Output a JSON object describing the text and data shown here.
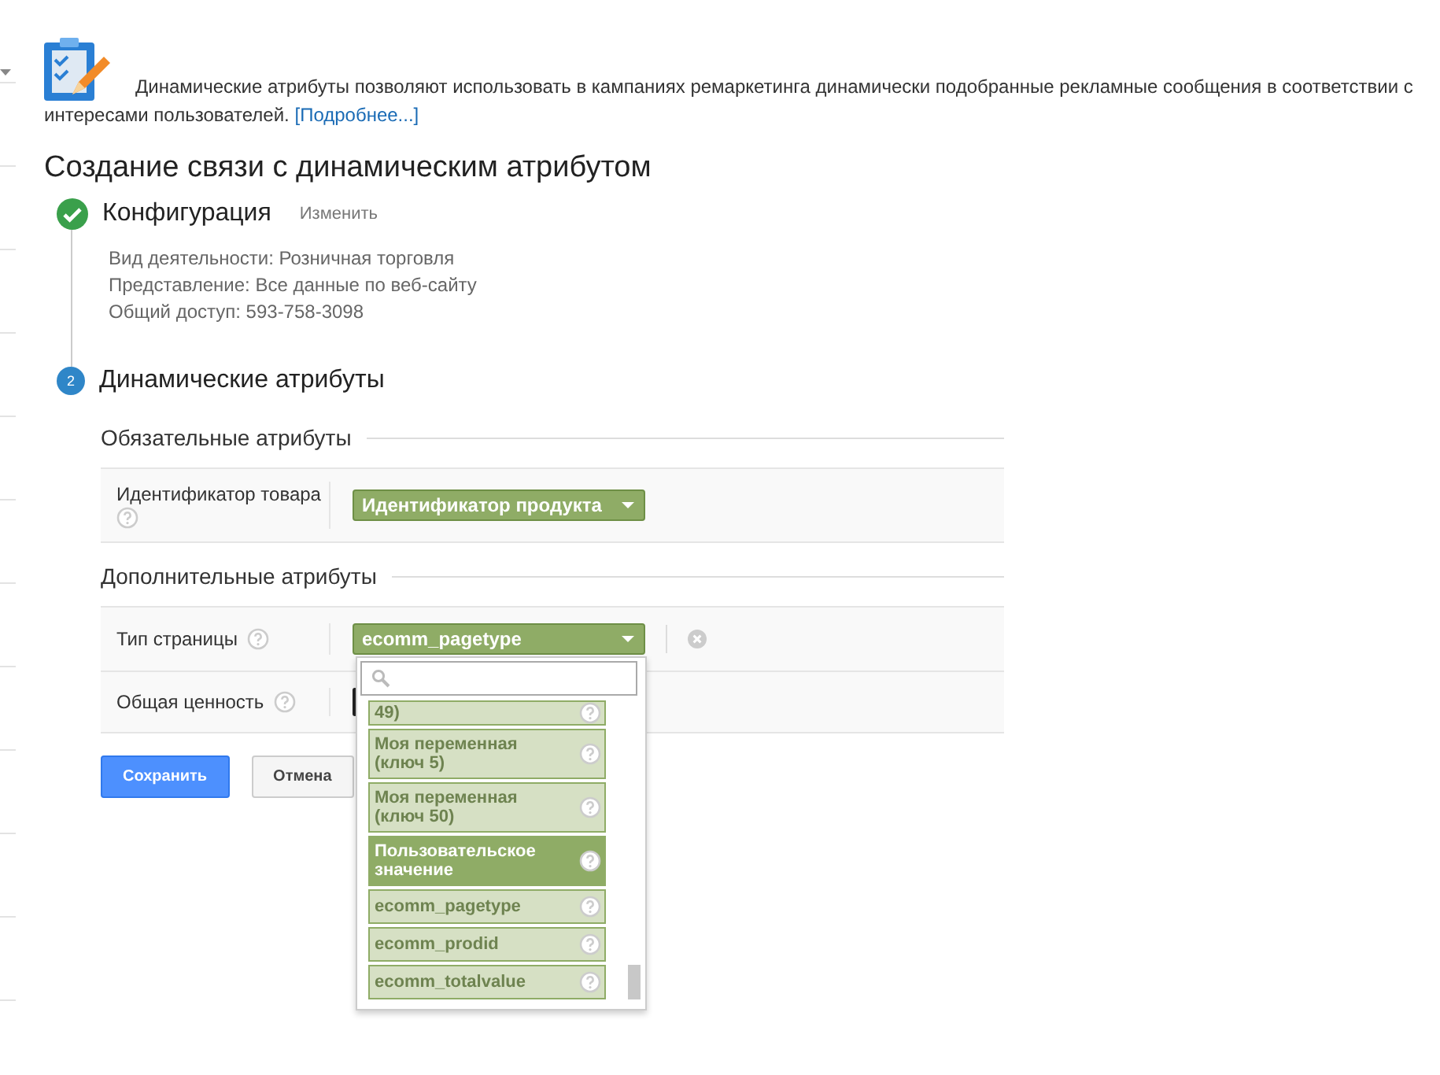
{
  "intro": {
    "text": "Динамические атрибуты позволяют использовать в кампаниях ремаркетинга динамически подобранные рекламные сообщения в соответствии с интересами пользователей.",
    "link": "[Подробнее...]"
  },
  "title": "Создание связи с динамическим атрибутом",
  "steps": [
    {
      "kind": "done",
      "title": "Конфигурация",
      "action": "Изменить",
      "details": [
        "Вид деятельности: Розничная торговля",
        "Представление: Все данные по веб-сайту",
        "Общий доступ: 593-758-3098"
      ]
    },
    {
      "kind": "number",
      "number": "2",
      "title": "Динамические атрибуты"
    }
  ],
  "sections": [
    {
      "title": "Обязательные атрибуты",
      "rows": [
        {
          "label": "Идентификатор товара",
          "value": "Идентификатор продукта",
          "removable": false,
          "open": false
        }
      ]
    },
    {
      "title": "Дополнительные атрибуты",
      "rows": [
        {
          "label": "Тип страницы",
          "value": "ecomm_pagetype",
          "removable": true,
          "open": true
        },
        {
          "label": "Общая ценность",
          "value": "",
          "removable": false,
          "open": false
        }
      ]
    }
  ],
  "dropdown": {
    "options": [
      {
        "label": "49)",
        "selected": false
      },
      {
        "label": "Моя переменная (ключ 5)",
        "selected": false
      },
      {
        "label": "Моя переменная (ключ 50)",
        "selected": false
      },
      {
        "label": "Пользовательское значение",
        "selected": true
      },
      {
        "label": "ecomm_pagetype",
        "selected": false
      },
      {
        "label": "ecomm_prodid",
        "selected": false
      },
      {
        "label": "ecomm_totalvalue",
        "selected": false
      }
    ]
  },
  "buttons": [
    {
      "label": "Сохранить",
      "kind": "primary"
    },
    {
      "label": "Отмена",
      "kind": "default"
    }
  ]
}
